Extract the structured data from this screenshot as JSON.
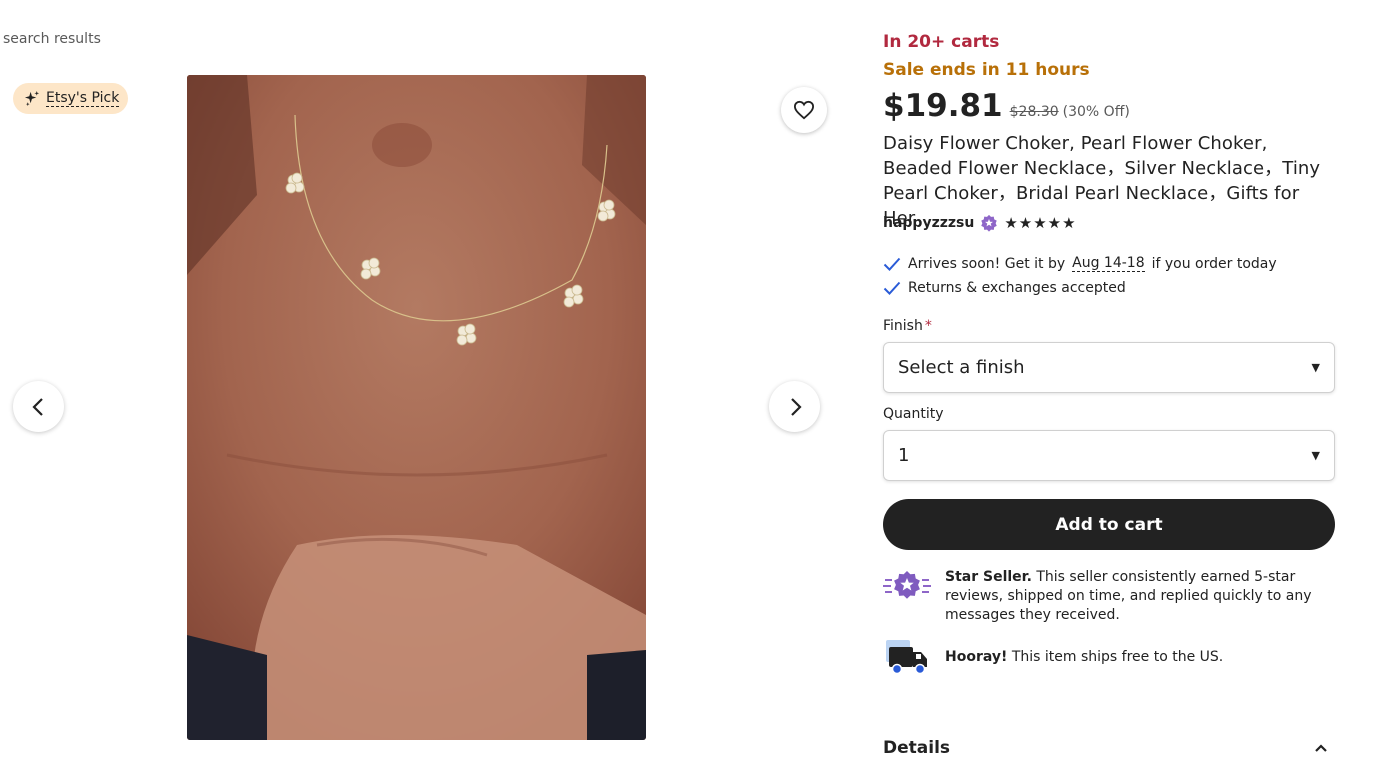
{
  "nav": {
    "back_link": "search results"
  },
  "badge": {
    "label": "Etsy's Pick"
  },
  "gallery": {
    "image_alt": "Daisy flower pearl choker worn on neck"
  },
  "listing": {
    "in_carts": "In 20+ carts",
    "sale_ends": "Sale ends in 11 hours",
    "price": "$19.81",
    "original_price": "$28.30",
    "discount": "(30% Off)",
    "title": "Daisy Flower Choker, Pearl Flower Choker, Beaded Flower Necklace，Silver Necklace，Tiny Pearl Choker，Bridal Pearl Necklace，Gifts for Her",
    "seller": "happyzzzsu",
    "rating": "★★★★★"
  },
  "shipping": {
    "arrives_prefix": "Arrives soon! Get it by",
    "arrives_date": "Aug 14-18",
    "arrives_suffix": "if you order today",
    "returns": "Returns & exchanges accepted"
  },
  "form": {
    "finish_label": "Finish",
    "finish_required": "*",
    "finish_value": "Select a finish",
    "quantity_label": "Quantity",
    "quantity_value": "1",
    "add_to_cart": "Add to cart"
  },
  "perks": {
    "star_bold": "Star Seller.",
    "star_text": "This seller consistently earned 5-star reviews, shipped on time, and replied quickly to any messages they received.",
    "ship_bold": "Hooray!",
    "ship_text": "This item ships free to the US."
  },
  "details": {
    "title": "Details"
  },
  "colors": {
    "carts": "#b1293f",
    "sale": "#b87008",
    "button": "#222222",
    "badge_bg": "#fde6c8",
    "star_seller": "#7f5bbf"
  }
}
